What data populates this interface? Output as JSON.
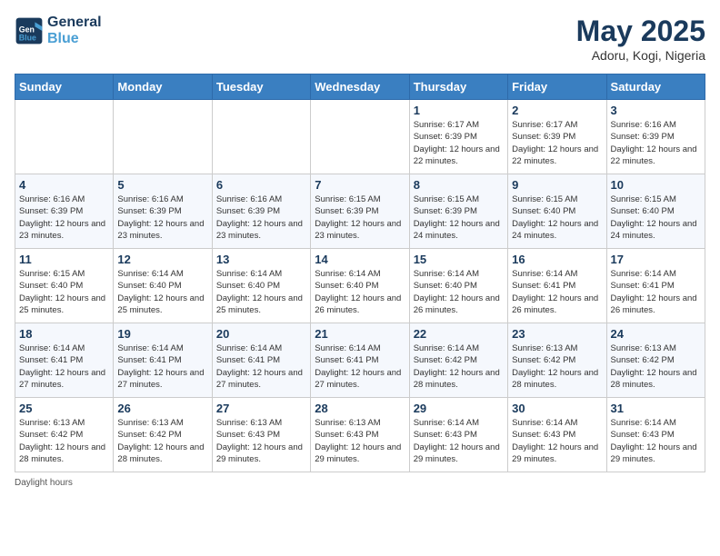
{
  "header": {
    "logo_line1": "General",
    "logo_line2": "Blue",
    "month_title": "May 2025",
    "location": "Adoru, Kogi, Nigeria"
  },
  "days_of_week": [
    "Sunday",
    "Monday",
    "Tuesday",
    "Wednesday",
    "Thursday",
    "Friday",
    "Saturday"
  ],
  "weeks": [
    [
      {
        "day": "",
        "info": ""
      },
      {
        "day": "",
        "info": ""
      },
      {
        "day": "",
        "info": ""
      },
      {
        "day": "",
        "info": ""
      },
      {
        "day": "1",
        "info": "Sunrise: 6:17 AM\nSunset: 6:39 PM\nDaylight: 12 hours and 22 minutes."
      },
      {
        "day": "2",
        "info": "Sunrise: 6:17 AM\nSunset: 6:39 PM\nDaylight: 12 hours and 22 minutes."
      },
      {
        "day": "3",
        "info": "Sunrise: 6:16 AM\nSunset: 6:39 PM\nDaylight: 12 hours and 22 minutes."
      }
    ],
    [
      {
        "day": "4",
        "info": "Sunrise: 6:16 AM\nSunset: 6:39 PM\nDaylight: 12 hours and 23 minutes."
      },
      {
        "day": "5",
        "info": "Sunrise: 6:16 AM\nSunset: 6:39 PM\nDaylight: 12 hours and 23 minutes."
      },
      {
        "day": "6",
        "info": "Sunrise: 6:16 AM\nSunset: 6:39 PM\nDaylight: 12 hours and 23 minutes."
      },
      {
        "day": "7",
        "info": "Sunrise: 6:15 AM\nSunset: 6:39 PM\nDaylight: 12 hours and 23 minutes."
      },
      {
        "day": "8",
        "info": "Sunrise: 6:15 AM\nSunset: 6:39 PM\nDaylight: 12 hours and 24 minutes."
      },
      {
        "day": "9",
        "info": "Sunrise: 6:15 AM\nSunset: 6:40 PM\nDaylight: 12 hours and 24 minutes."
      },
      {
        "day": "10",
        "info": "Sunrise: 6:15 AM\nSunset: 6:40 PM\nDaylight: 12 hours and 24 minutes."
      }
    ],
    [
      {
        "day": "11",
        "info": "Sunrise: 6:15 AM\nSunset: 6:40 PM\nDaylight: 12 hours and 25 minutes."
      },
      {
        "day": "12",
        "info": "Sunrise: 6:14 AM\nSunset: 6:40 PM\nDaylight: 12 hours and 25 minutes."
      },
      {
        "day": "13",
        "info": "Sunrise: 6:14 AM\nSunset: 6:40 PM\nDaylight: 12 hours and 25 minutes."
      },
      {
        "day": "14",
        "info": "Sunrise: 6:14 AM\nSunset: 6:40 PM\nDaylight: 12 hours and 26 minutes."
      },
      {
        "day": "15",
        "info": "Sunrise: 6:14 AM\nSunset: 6:40 PM\nDaylight: 12 hours and 26 minutes."
      },
      {
        "day": "16",
        "info": "Sunrise: 6:14 AM\nSunset: 6:41 PM\nDaylight: 12 hours and 26 minutes."
      },
      {
        "day": "17",
        "info": "Sunrise: 6:14 AM\nSunset: 6:41 PM\nDaylight: 12 hours and 26 minutes."
      }
    ],
    [
      {
        "day": "18",
        "info": "Sunrise: 6:14 AM\nSunset: 6:41 PM\nDaylight: 12 hours and 27 minutes."
      },
      {
        "day": "19",
        "info": "Sunrise: 6:14 AM\nSunset: 6:41 PM\nDaylight: 12 hours and 27 minutes."
      },
      {
        "day": "20",
        "info": "Sunrise: 6:14 AM\nSunset: 6:41 PM\nDaylight: 12 hours and 27 minutes."
      },
      {
        "day": "21",
        "info": "Sunrise: 6:14 AM\nSunset: 6:41 PM\nDaylight: 12 hours and 27 minutes."
      },
      {
        "day": "22",
        "info": "Sunrise: 6:14 AM\nSunset: 6:42 PM\nDaylight: 12 hours and 28 minutes."
      },
      {
        "day": "23",
        "info": "Sunrise: 6:13 AM\nSunset: 6:42 PM\nDaylight: 12 hours and 28 minutes."
      },
      {
        "day": "24",
        "info": "Sunrise: 6:13 AM\nSunset: 6:42 PM\nDaylight: 12 hours and 28 minutes."
      }
    ],
    [
      {
        "day": "25",
        "info": "Sunrise: 6:13 AM\nSunset: 6:42 PM\nDaylight: 12 hours and 28 minutes."
      },
      {
        "day": "26",
        "info": "Sunrise: 6:13 AM\nSunset: 6:42 PM\nDaylight: 12 hours and 28 minutes."
      },
      {
        "day": "27",
        "info": "Sunrise: 6:13 AM\nSunset: 6:43 PM\nDaylight: 12 hours and 29 minutes."
      },
      {
        "day": "28",
        "info": "Sunrise: 6:13 AM\nSunset: 6:43 PM\nDaylight: 12 hours and 29 minutes."
      },
      {
        "day": "29",
        "info": "Sunrise: 6:14 AM\nSunset: 6:43 PM\nDaylight: 12 hours and 29 minutes."
      },
      {
        "day": "30",
        "info": "Sunrise: 6:14 AM\nSunset: 6:43 PM\nDaylight: 12 hours and 29 minutes."
      },
      {
        "day": "31",
        "info": "Sunrise: 6:14 AM\nSunset: 6:43 PM\nDaylight: 12 hours and 29 minutes."
      }
    ]
  ],
  "footer": {
    "note": "Daylight hours"
  }
}
